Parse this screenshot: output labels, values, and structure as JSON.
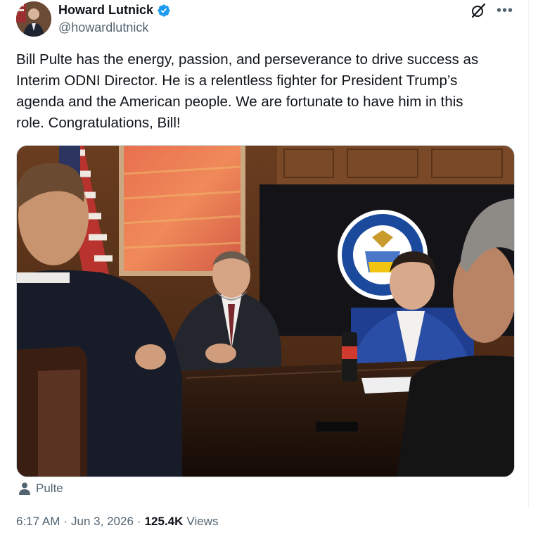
{
  "author": {
    "display_name": "Howard Lutnick",
    "handle": "@howardlutnick",
    "verified": true,
    "verified_color": "#1d9bf0"
  },
  "icons": {
    "grok": "grok-icon",
    "more": "more-horizontal-icon",
    "user_tag": "person-icon",
    "verified": "verified-badge-icon"
  },
  "tweet": {
    "text": "Bill Pulte has the energy, passion, and perseverance to drive success as\nInterim ODNI Director. He is a relentless fighter for President Trump’s\nagenda and the American people. We are fortunate to have him in this\nrole. Congratulations, Bill!"
  },
  "media": {
    "tagged_user": "Pulte"
  },
  "meta": {
    "time": "6:17 AM",
    "date": "Jun 3, 2026",
    "separator": "·",
    "views_count": "125.4K",
    "views_label": "Views"
  },
  "colors": {
    "text_primary": "#0f1419",
    "text_secondary": "#536471",
    "border": "#cfd9de"
  }
}
